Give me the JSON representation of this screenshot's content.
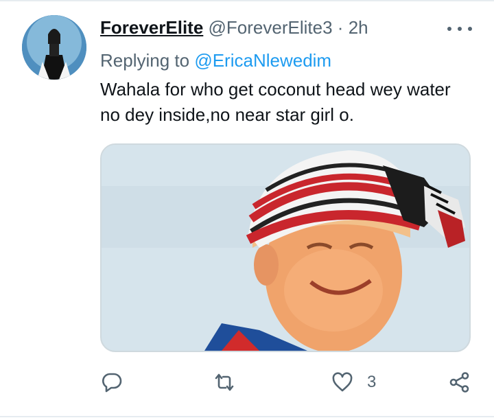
{
  "tweet": {
    "author": {
      "display_name": "ForeverElite",
      "handle": "@ForeverElite3",
      "separator": "·",
      "time": "2h"
    },
    "replying_to": {
      "prefix": "Replying to",
      "mention": "@EricaNlewedim"
    },
    "text": "Wahala for who get coconut head wey water no dey inside,no near star girl o.",
    "actions": {
      "like_count": "3"
    }
  },
  "icons": {
    "more": "more-horizontal-icon",
    "reply": "reply-icon",
    "retweet": "retweet-icon",
    "like": "heart-icon",
    "share": "share-icon"
  },
  "colors": {
    "text_primary": "#0f1419",
    "text_secondary": "#536471",
    "link": "#1d9bf0",
    "border": "#cfd9de"
  }
}
